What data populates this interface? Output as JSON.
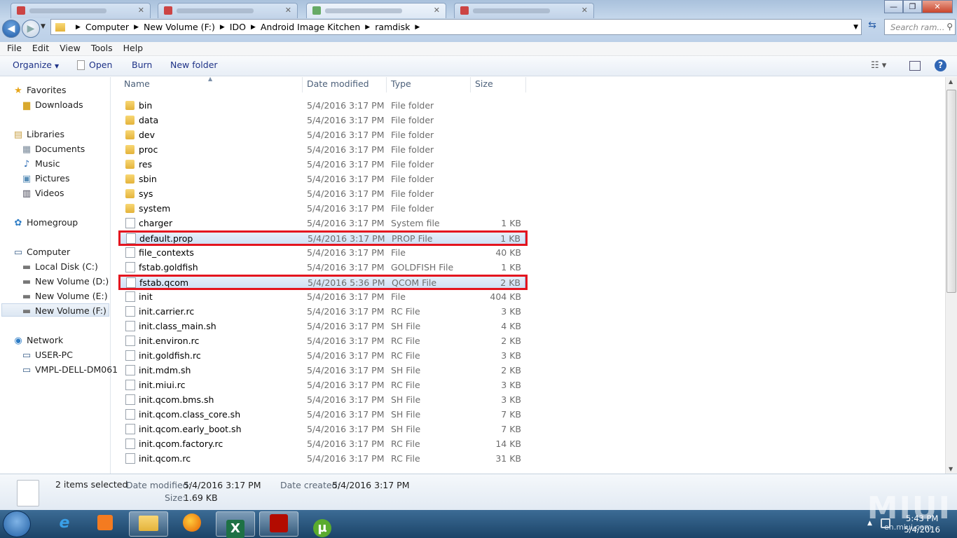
{
  "browser_tabs": [
    {
      "label": ""
    },
    {
      "label": ""
    },
    {
      "label": ""
    },
    {
      "label": ""
    }
  ],
  "window_controls": {
    "minimize": "—",
    "restore": "❐",
    "close": "✕"
  },
  "address": {
    "crumbs": [
      "Computer",
      "New Volume (F:)",
      "IDO",
      "Android Image Kitchen",
      "ramdisk"
    ],
    "search_placeholder": "Search ram..."
  },
  "menu": [
    "File",
    "Edit",
    "View",
    "Tools",
    "Help"
  ],
  "toolbar": {
    "organize": "Organize",
    "open": "Open",
    "burn": "Burn",
    "new_folder": "New folder"
  },
  "columns": {
    "name": "Name",
    "date": "Date modified",
    "type": "Type",
    "size": "Size"
  },
  "nav": {
    "favorites": "Favorites",
    "downloads": "Downloads",
    "libraries": "Libraries",
    "documents": "Documents",
    "music": "Music",
    "pictures": "Pictures",
    "videos": "Videos",
    "homegroup": "Homegroup",
    "computer": "Computer",
    "local_c": "Local Disk (C:)",
    "vol_d": "New Volume (D:)",
    "vol_e": "New Volume (E:)",
    "vol_f": "New Volume (F:)",
    "network": "Network",
    "user_pc": "USER-PC",
    "vmpl": "VMPL-DELL-DM061"
  },
  "files": [
    {
      "name": "bin",
      "date": "5/4/2016 3:17 PM",
      "type": "File folder",
      "size": "",
      "kind": "folder"
    },
    {
      "name": "data",
      "date": "5/4/2016 3:17 PM",
      "type": "File folder",
      "size": "",
      "kind": "folder"
    },
    {
      "name": "dev",
      "date": "5/4/2016 3:17 PM",
      "type": "File folder",
      "size": "",
      "kind": "folder"
    },
    {
      "name": "proc",
      "date": "5/4/2016 3:17 PM",
      "type": "File folder",
      "size": "",
      "kind": "folder"
    },
    {
      "name": "res",
      "date": "5/4/2016 3:17 PM",
      "type": "File folder",
      "size": "",
      "kind": "folder"
    },
    {
      "name": "sbin",
      "date": "5/4/2016 3:17 PM",
      "type": "File folder",
      "size": "",
      "kind": "folder"
    },
    {
      "name": "sys",
      "date": "5/4/2016 3:17 PM",
      "type": "File folder",
      "size": "",
      "kind": "folder"
    },
    {
      "name": "system",
      "date": "5/4/2016 3:17 PM",
      "type": "File folder",
      "size": "",
      "kind": "folder"
    },
    {
      "name": "charger",
      "date": "5/4/2016 3:17 PM",
      "type": "System file",
      "size": "1 KB",
      "kind": "file"
    },
    {
      "name": "default.prop",
      "date": "5/4/2016 3:17 PM",
      "type": "PROP File",
      "size": "1 KB",
      "kind": "file",
      "selected": true
    },
    {
      "name": "file_contexts",
      "date": "5/4/2016 3:17 PM",
      "type": "File",
      "size": "40 KB",
      "kind": "file"
    },
    {
      "name": "fstab.goldfish",
      "date": "5/4/2016 3:17 PM",
      "type": "GOLDFISH File",
      "size": "1 KB",
      "kind": "file"
    },
    {
      "name": "fstab.qcom",
      "date": "5/4/2016 5:36 PM",
      "type": "QCOM File",
      "size": "2 KB",
      "kind": "file",
      "selected": true
    },
    {
      "name": "init",
      "date": "5/4/2016 3:17 PM",
      "type": "File",
      "size": "404 KB",
      "kind": "file"
    },
    {
      "name": "init.carrier.rc",
      "date": "5/4/2016 3:17 PM",
      "type": "RC File",
      "size": "3 KB",
      "kind": "file"
    },
    {
      "name": "init.class_main.sh",
      "date": "5/4/2016 3:17 PM",
      "type": "SH File",
      "size": "4 KB",
      "kind": "file"
    },
    {
      "name": "init.environ.rc",
      "date": "5/4/2016 3:17 PM",
      "type": "RC File",
      "size": "2 KB",
      "kind": "file"
    },
    {
      "name": "init.goldfish.rc",
      "date": "5/4/2016 3:17 PM",
      "type": "RC File",
      "size": "3 KB",
      "kind": "file"
    },
    {
      "name": "init.mdm.sh",
      "date": "5/4/2016 3:17 PM",
      "type": "SH File",
      "size": "2 KB",
      "kind": "file"
    },
    {
      "name": "init.miui.rc",
      "date": "5/4/2016 3:17 PM",
      "type": "RC File",
      "size": "3 KB",
      "kind": "file"
    },
    {
      "name": "init.qcom.bms.sh",
      "date": "5/4/2016 3:17 PM",
      "type": "SH File",
      "size": "3 KB",
      "kind": "file"
    },
    {
      "name": "init.qcom.class_core.sh",
      "date": "5/4/2016 3:17 PM",
      "type": "SH File",
      "size": "7 KB",
      "kind": "file"
    },
    {
      "name": "init.qcom.early_boot.sh",
      "date": "5/4/2016 3:17 PM",
      "type": "SH File",
      "size": "7 KB",
      "kind": "file"
    },
    {
      "name": "init.qcom.factory.rc",
      "date": "5/4/2016 3:17 PM",
      "type": "RC File",
      "size": "14 KB",
      "kind": "file"
    },
    {
      "name": "init.qcom.rc",
      "date": "5/4/2016 3:17 PM",
      "type": "RC File",
      "size": "31 KB",
      "kind": "file"
    }
  ],
  "details": {
    "selected": "2 items selected",
    "date_modified_label": "Date modified:",
    "date_modified": "5/4/2016 3:17 PM",
    "date_created_label": "Date created:",
    "date_created": "5/4/2016 3:17 PM",
    "size_label": "Size:",
    "size": "1.69 KB"
  },
  "taskbar": {
    "time": "5:43 PM",
    "date": "5/4/2016",
    "excel_glyph": "X",
    "utorrent_glyph": "µ"
  },
  "watermark": {
    "logo": "MIUI",
    "url": "en.miui.com"
  },
  "colors": {
    "highlight_box": "#e4151f"
  }
}
